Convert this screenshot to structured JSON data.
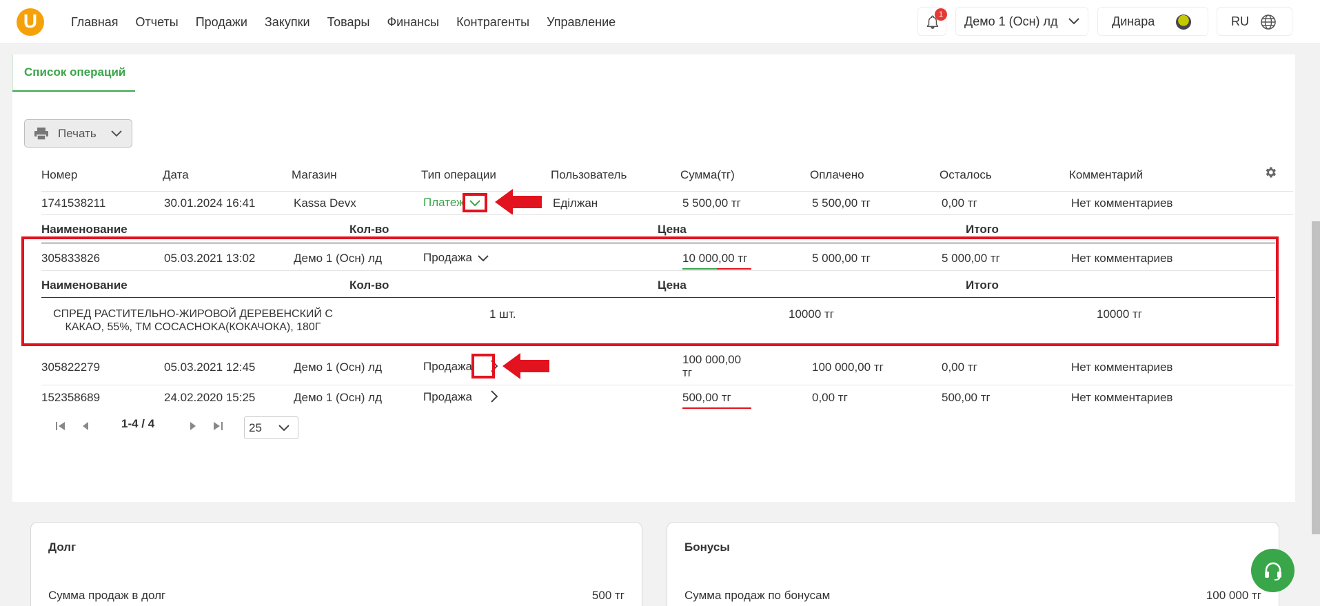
{
  "nav": {
    "logo": "U",
    "items": [
      "Главная",
      "Отчеты",
      "Продажи",
      "Закупки",
      "Товары",
      "Финансы",
      "Контрагенты",
      "Управление"
    ]
  },
  "header": {
    "notification_count": "1",
    "store_select": "Демо 1 (Осн) лд",
    "user_name": "Динара",
    "language": "RU"
  },
  "tabs": {
    "active": "Список операций"
  },
  "toolbar": {
    "print_label": "Печать"
  },
  "table": {
    "columns": [
      "Номер",
      "Дата",
      "Магазин",
      "Тип операции",
      "Пользователь",
      "Сумма(тг)",
      "Оплачено",
      "Осталось",
      "Комментарий"
    ],
    "detail_columns": [
      "Наименование",
      "Кол-во",
      "Цена",
      "Итого"
    ],
    "rows": [
      {
        "number": "1741538211",
        "date": "30.01.2024 16:41",
        "store": "Kassa Devx",
        "type": "Платеж",
        "user": "Еділжан",
        "sum": "5 500,00 тг",
        "paid": "5 500,00 тг",
        "left": "0,00 тг",
        "comment": "Нет комментариев"
      },
      {
        "number": "305833826",
        "date": "05.03.2021 13:02",
        "store": "Демо 1 (Осн) лд",
        "type": "Продажа",
        "user": "",
        "sum": "10 000,00 тг",
        "paid": "5 000,00 тг",
        "left": "5 000,00 тг",
        "comment": "Нет комментариев"
      },
      {
        "number": "305822279",
        "date": "05.03.2021 12:45",
        "store": "Демо 1 (Осн) лд",
        "type": "Продажа",
        "user": "",
        "sum_line1": "100 000,00",
        "sum_line2": "тг",
        "paid": "100 000,00 тг",
        "left": "0,00 тг",
        "comment": "Нет комментариев"
      },
      {
        "number": "152358689",
        "date": "24.02.2020 15:25",
        "store": "Демо 1 (Осн) лд",
        "type": "Продажа",
        "user": "",
        "sum": "500,00 тг",
        "paid": "0,00 тг",
        "left": "500,00 тг",
        "comment": "Нет комментариев"
      }
    ],
    "detail_item": {
      "name_line1": "СПРЕД РАСТИТЕЛЬНО-ЖИРОВОЙ ДЕРЕВЕНСКИЙ С",
      "name_line2": "КАКАО, 55%, ТМ COCACHOKA(КОКАЧОКА), 180Г",
      "qty": "1 шт.",
      "price": "10000 тг",
      "total": "10000 тг"
    }
  },
  "pagination": {
    "range": "1-4 / 4",
    "page_size": "25"
  },
  "debt_panel": {
    "title": "Долг",
    "row_label": "Сумма продаж в долг",
    "row_value": "500 тг"
  },
  "bonus_panel": {
    "title": "Бонусы",
    "row_label": "Сумма продаж по бонусам",
    "row_value": "100 000 тг"
  },
  "colors": {
    "accent": "#3aa64a",
    "annotation": "#e3121f",
    "logo": "#f5a20a"
  }
}
